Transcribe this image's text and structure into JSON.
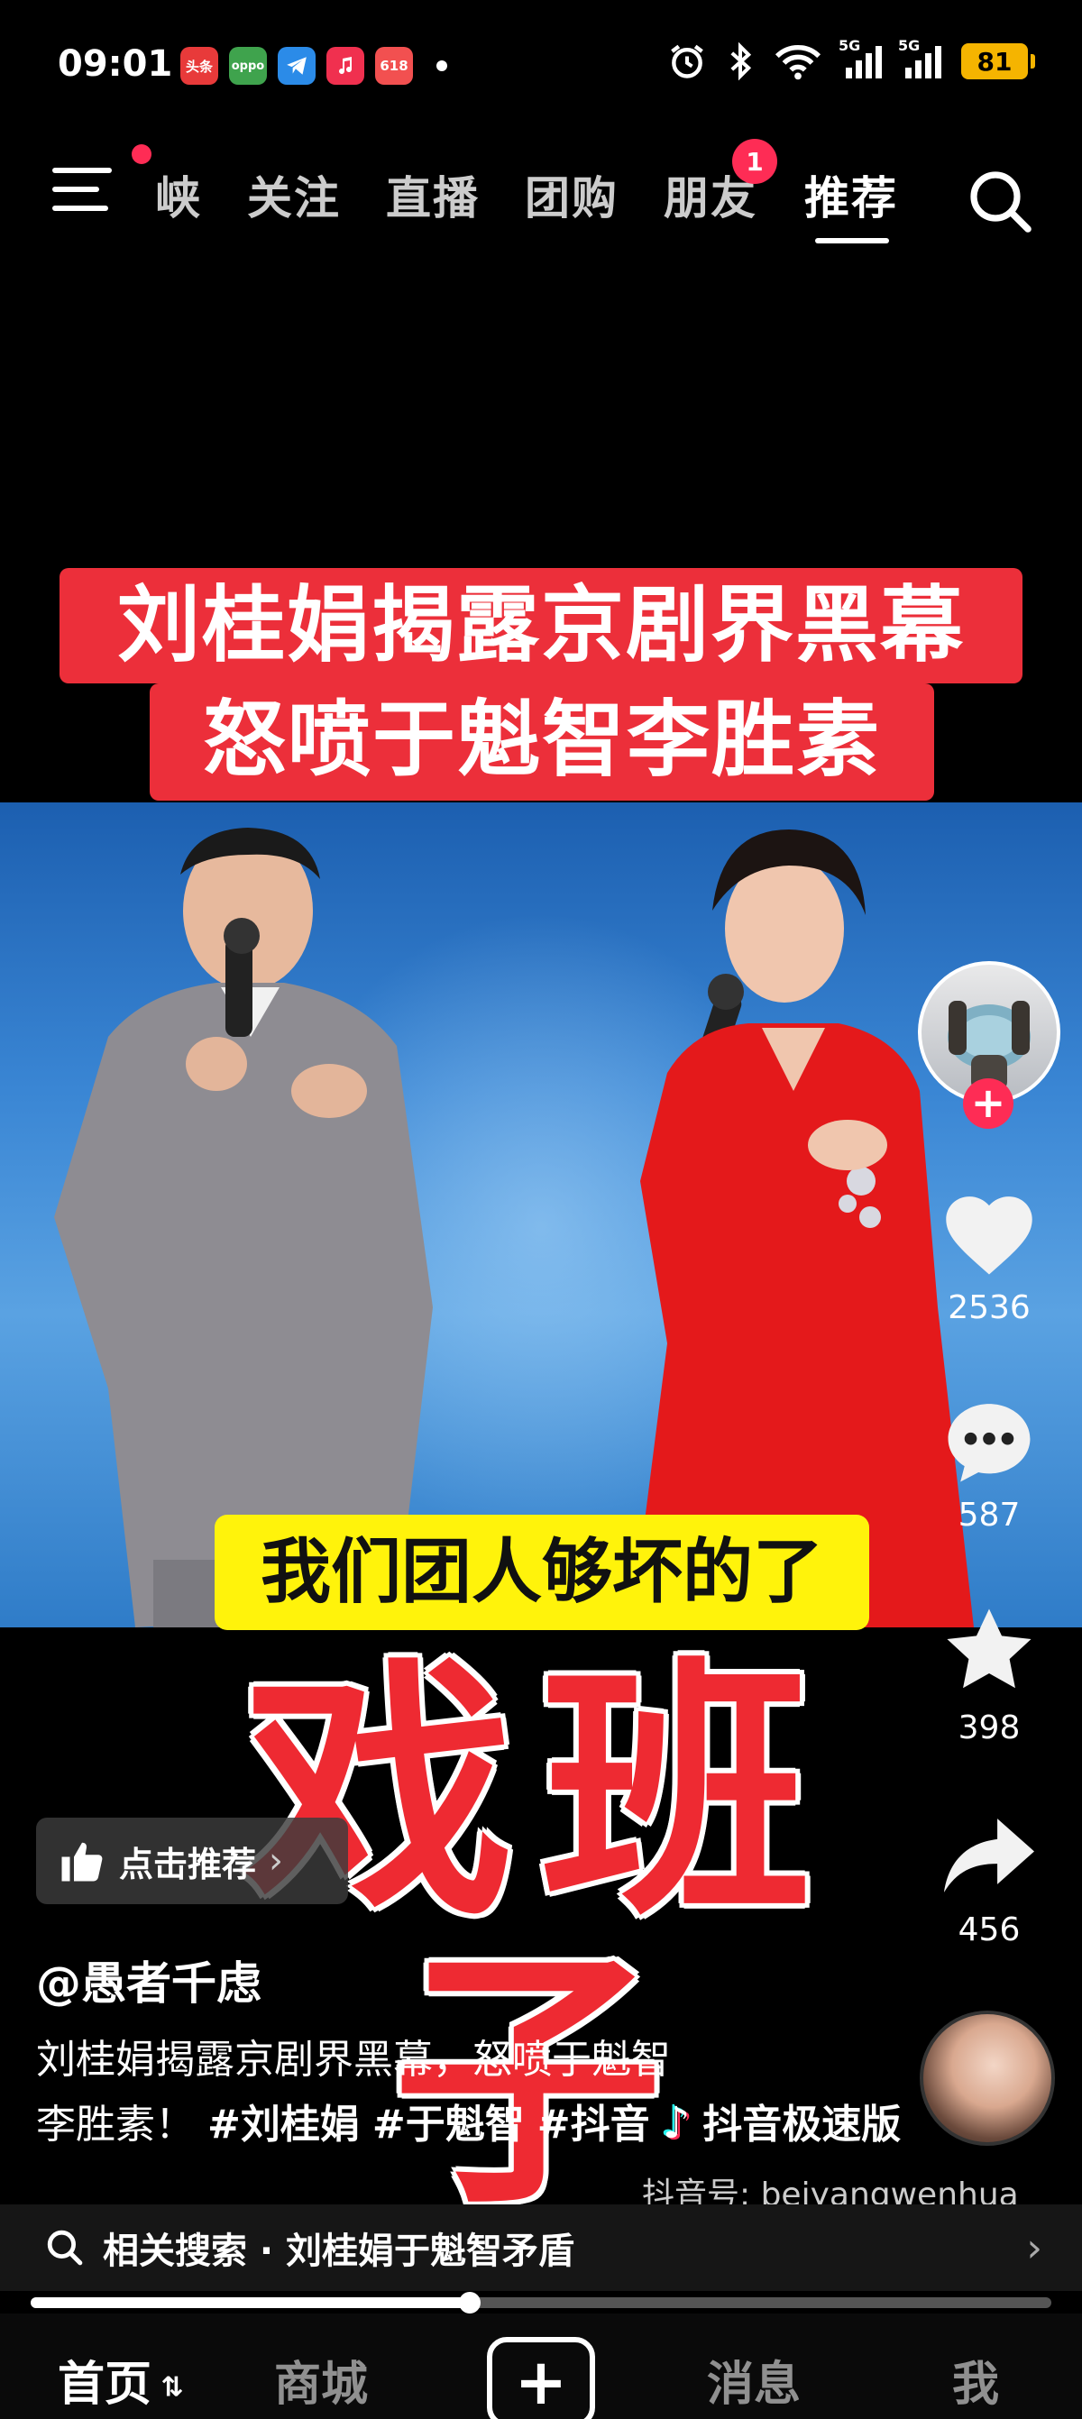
{
  "status_bar": {
    "time": "09:01",
    "app_icons": [
      {
        "label": "头条",
        "color": "#e83a3a"
      },
      {
        "label": "oppo",
        "color": "#3fa34d"
      },
      {
        "label": "",
        "color": "#2b8be8"
      },
      {
        "label": "",
        "color": "#f0304f"
      },
      {
        "label": "618",
        "color": "#f25050"
      }
    ],
    "network_1": "5G",
    "network_2": "5G",
    "battery": "81"
  },
  "top_nav": {
    "tabs": [
      {
        "label": "峡",
        "active": false
      },
      {
        "label": "关注",
        "active": false
      },
      {
        "label": "直播",
        "active": false
      },
      {
        "label": "团购",
        "active": false
      },
      {
        "label": "朋友",
        "active": false
      },
      {
        "label": "推荐",
        "active": true
      }
    ],
    "friends_badge": "1"
  },
  "video": {
    "title_line1": "刘桂娟揭露京剧界黑幕",
    "title_line2": "怒喷于魁智李胜素",
    "subtitle": "我们团人够坏的了",
    "big_text": "戏班子"
  },
  "actions": {
    "likes": "2536",
    "comments": "587",
    "favorites": "398",
    "shares": "456"
  },
  "info": {
    "recommend_label": "点击推荐",
    "author": "@愚者千虑",
    "desc_line1": "刘桂娟揭露京剧界黑幕，怒喷于魁智",
    "desc_line2_text": "李胜素！",
    "tags": [
      "#刘桂娟",
      "#于魁智",
      "#抖音"
    ],
    "watermark_brand": "抖音极速版",
    "watermark_id": "抖音号: beiyangwenhua"
  },
  "related_search": {
    "text": "相关搜索 · 刘桂娟于魁智矛盾"
  },
  "progress": 0.43,
  "bottom_nav": {
    "home": "首页",
    "mall": "商城",
    "messages": "消息",
    "me": "我"
  },
  "colors": {
    "accent": "#fe2c55",
    "title_red": "#ec2f3a",
    "subtitle_yellow": "#fff30b"
  }
}
